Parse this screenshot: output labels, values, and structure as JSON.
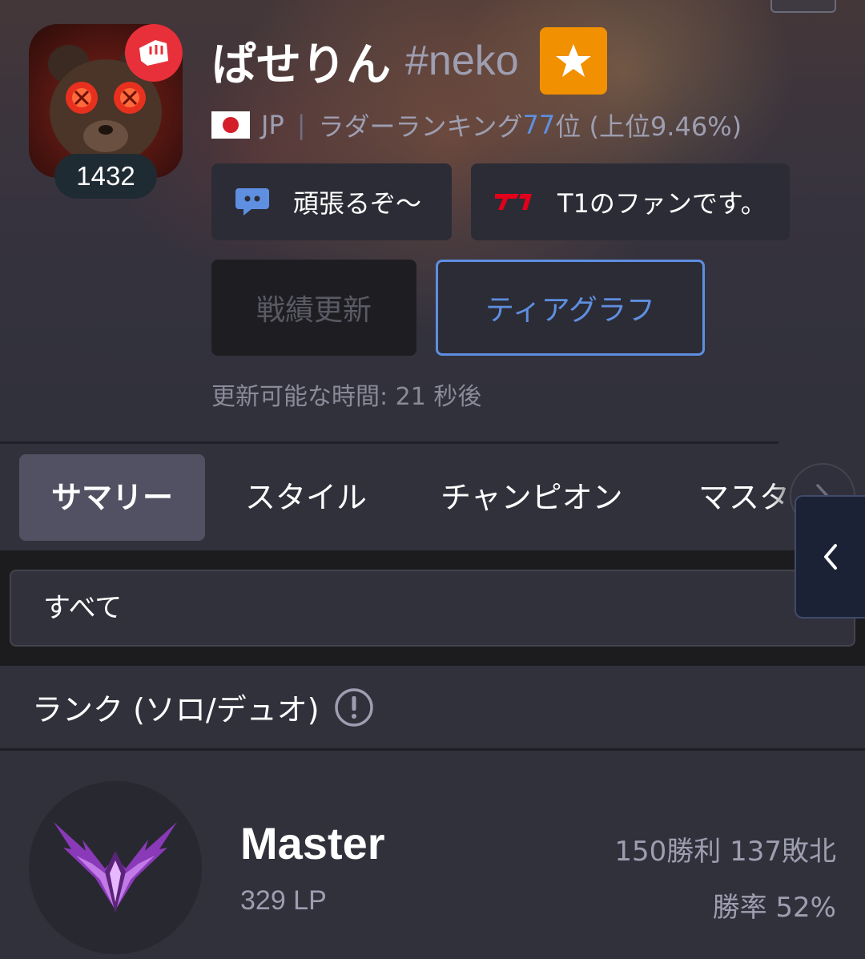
{
  "profile": {
    "name": "ぱせりん",
    "tag": "#neko",
    "level": "1432",
    "region": "JP",
    "ladder_prefix": "ラダーランキング",
    "ladder_rank": "77",
    "ladder_suffix": "位 (上位9.46%)",
    "region_separator": "|"
  },
  "tags": [
    {
      "icon": "discord-icon",
      "label": "頑張るぞ～"
    },
    {
      "icon": "t1-logo-icon",
      "label": "T1のファンです。"
    }
  ],
  "actions": {
    "renew_label": "戦績更新",
    "tier_graph_label": "ティアグラフ",
    "update_note": "更新可能な時間: 21 秒後"
  },
  "tabs": [
    {
      "label": "サマリー",
      "active": true
    },
    {
      "label": "スタイル",
      "active": false
    },
    {
      "label": "チャンピオン",
      "active": false
    },
    {
      "label": "マスタ",
      "active": false
    }
  ],
  "filter": {
    "selected": "すべて"
  },
  "rank": {
    "header": "ランク (ソロ/デュオ)",
    "tier": "Master",
    "lp": "329 LP",
    "record": "150勝利 137敗北",
    "winrate": "勝率 52%"
  },
  "colors": {
    "accent_blue": "#5e8fe0",
    "star_orange": "#f19000",
    "riot_red": "#e8303a",
    "background": "#31313c"
  }
}
